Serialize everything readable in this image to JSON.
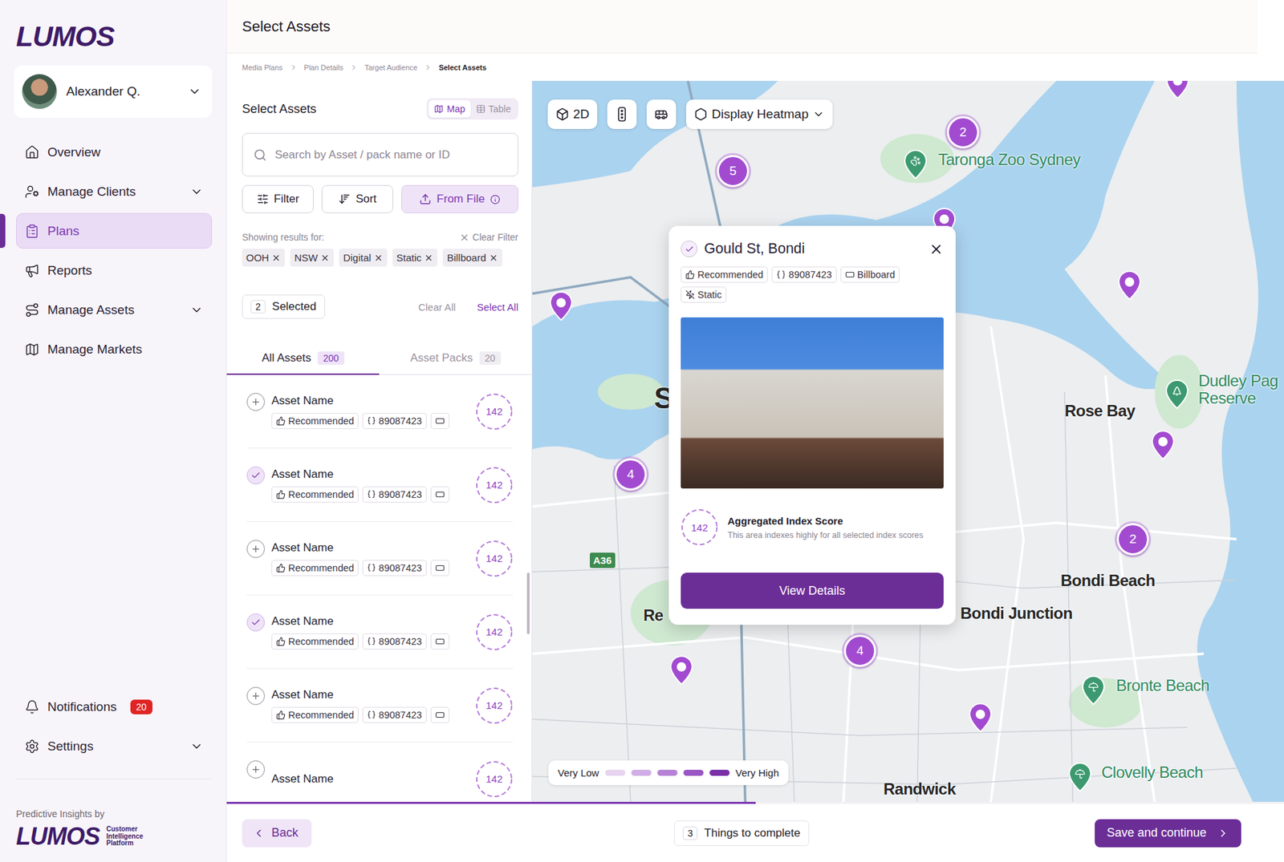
{
  "sidebar": {
    "logo": "LUMOS",
    "user": {
      "name": "Alexander Q."
    },
    "items": [
      {
        "label": "Overview",
        "expandable": false,
        "selected": false
      },
      {
        "label": "Manage Clients",
        "expandable": true,
        "selected": false
      },
      {
        "label": "Plans",
        "expandable": false,
        "selected": true
      },
      {
        "label": "Reports",
        "expandable": false,
        "selected": false
      },
      {
        "label": "Manage Assets",
        "expandable": true,
        "selected": false
      },
      {
        "label": "Manage Markets",
        "expandable": false,
        "selected": false
      }
    ],
    "bottom_items": [
      {
        "label": "Notifications",
        "badge": "20",
        "expandable": false
      },
      {
        "label": "Settings",
        "badge": "",
        "expandable": true
      }
    ],
    "footer": {
      "caption": "Predictive Insights by",
      "logo": "LUMOS",
      "tagline": [
        "Customer",
        "Intelligence",
        "Platform"
      ]
    }
  },
  "header": {
    "title": "Select Assets"
  },
  "breadcrumbs": [
    {
      "label": "Media Plans",
      "current": false
    },
    {
      "label": "Plan Details",
      "current": false
    },
    {
      "label": "Target Audience",
      "current": false
    },
    {
      "label": "Select Assets",
      "current": true
    }
  ],
  "panel": {
    "title": "Select Assets",
    "view_toggle": [
      {
        "label": "Map",
        "selected": true
      },
      {
        "label": "Table",
        "selected": false
      }
    ],
    "search": {
      "placeholder": "Search by Asset / pack name or ID"
    },
    "actions": [
      {
        "label": "Filter",
        "kind": "filter"
      },
      {
        "label": "Sort",
        "kind": "sort"
      },
      {
        "label": "From File",
        "kind": "file"
      }
    ],
    "filters": {
      "caption": "Showing results for:",
      "clear": "Clear Filter",
      "chips": [
        "OOH",
        "NSW",
        "Digital",
        "Static",
        "Billboard"
      ]
    },
    "selection": {
      "count": "2",
      "label": "Selected",
      "clear": "Clear All",
      "select_all": "Select All"
    },
    "tabs": [
      {
        "label": "All Assets",
        "count": "200",
        "selected": true
      },
      {
        "label": "Asset Packs",
        "count": "20",
        "selected": false
      }
    ],
    "assets": [
      {
        "name": "Asset Name",
        "tag": "Recommended",
        "id": "89087423",
        "score": "142",
        "checked": false
      },
      {
        "name": "Asset Name",
        "tag": "Recommended",
        "id": "89087423",
        "score": "142",
        "checked": true
      },
      {
        "name": "Asset Name",
        "tag": "Recommended",
        "id": "89087423",
        "score": "142",
        "checked": false
      },
      {
        "name": "Asset Name",
        "tag": "Recommended",
        "id": "89087423",
        "score": "142",
        "checked": true
      },
      {
        "name": "Asset Name",
        "tag": "Recommended",
        "id": "89087423",
        "score": "142",
        "checked": false
      },
      {
        "name": "Asset Name",
        "score": "142",
        "checked": false
      }
    ]
  },
  "map": {
    "toolbar": {
      "mode": "2D",
      "heatmap": "Display Heatmap"
    },
    "markers": [
      {
        "kind": "cluster",
        "count": "2"
      },
      {
        "kind": "cluster",
        "count": "5"
      },
      {
        "kind": "cluster",
        "count": "4"
      },
      {
        "kind": "cluster",
        "count": "2"
      },
      {
        "kind": "cluster",
        "count": "4"
      },
      {
        "kind": "pin"
      },
      {
        "kind": "pin"
      },
      {
        "kind": "pin"
      },
      {
        "kind": "pin"
      },
      {
        "kind": "pin"
      },
      {
        "kind": "pin"
      },
      {
        "kind": "pin"
      }
    ],
    "pois": [
      {
        "kind": "zoo",
        "lines": [
          "Taronga Zoo Sydney"
        ]
      },
      {
        "kind": "park",
        "lines": [
          "Dudley Pag",
          "Reserve"
        ]
      },
      {
        "kind": "beach",
        "lines": [
          "Bronte Beach"
        ]
      },
      {
        "kind": "beach",
        "lines": [
          "Clovelly Beach"
        ]
      }
    ],
    "labels": [
      {
        "text": "Rose Bay",
        "kind": "suburb"
      },
      {
        "text": "Bondi Beach",
        "kind": "suburb"
      },
      {
        "text": "Bondi Junction",
        "kind": "suburb"
      },
      {
        "text": "Randwick",
        "kind": "suburb"
      },
      {
        "text": "S",
        "kind": "city"
      },
      {
        "text": "Re",
        "kind": "suburb"
      }
    ],
    "road": "A36",
    "popup": {
      "title": "Gould St, Bondi",
      "checked": true,
      "tags": [
        {
          "label": "Recommended",
          "kind": "recommended"
        },
        {
          "label": "89087423",
          "kind": "id"
        },
        {
          "label": "Billboard",
          "kind": "billboard"
        },
        {
          "label": "Static",
          "kind": "static"
        }
      ],
      "score": "142",
      "score_title": "Aggregated Index Score",
      "score_note": "This area indexes highly for all selected index scores",
      "button": "View Details"
    },
    "legend": {
      "low": "Very Low",
      "high": "Very High",
      "steps": [
        {
          "color": "#e6d4f1"
        },
        {
          "color": "#d1ade6"
        },
        {
          "color": "#b682d6"
        },
        {
          "color": "#9a56c4"
        },
        {
          "color": "#7a2fa8"
        }
      ]
    }
  },
  "progress": {
    "level": 0.5
  },
  "footer": {
    "back": "Back",
    "todo_count": "3",
    "todo_label": "Things to complete",
    "save": "Save and continue"
  }
}
